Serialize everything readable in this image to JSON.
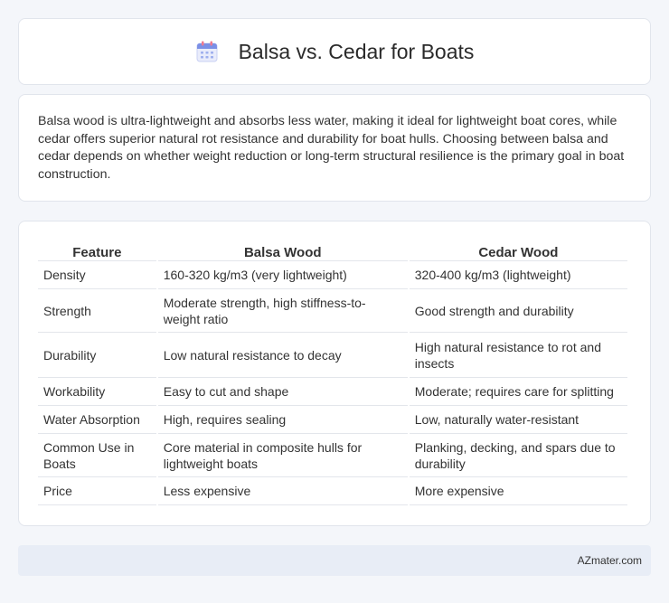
{
  "header": {
    "icon": "calendar-icon",
    "title": "Balsa vs. Cedar for Boats"
  },
  "intro": {
    "text": "Balsa wood is ultra-lightweight and absorbs less water, making it ideal for lightweight boat cores, while cedar offers superior natural rot resistance and durability for boat hulls. Choosing between balsa and cedar depends on whether weight reduction or long-term structural resilience is the primary goal in boat construction."
  },
  "table": {
    "headers": [
      "Feature",
      "Balsa Wood",
      "Cedar Wood"
    ],
    "rows": [
      [
        "Density",
        "160-320 kg/m3 (very lightweight)",
        "320-400 kg/m3 (lightweight)"
      ],
      [
        "Strength",
        "Moderate strength, high stiffness-to-weight ratio",
        "Good strength and durability"
      ],
      [
        "Durability",
        "Low natural resistance to decay",
        "High natural resistance to rot and insects"
      ],
      [
        "Workability",
        "Easy to cut and shape",
        "Moderate; requires care for splitting"
      ],
      [
        "Water Absorption",
        "High, requires sealing",
        "Low, naturally water-resistant"
      ],
      [
        "Common Use in Boats",
        "Core material in composite hulls for lightweight boats",
        "Planking, decking, and spars due to durability"
      ],
      [
        "Price",
        "Less expensive",
        "More expensive"
      ]
    ]
  },
  "footer": {
    "text": "AZmater.com"
  },
  "colors": {
    "background": "#f4f6fa",
    "card": "#ffffff",
    "footer": "#e8edf6",
    "icon_accent": "#7b8fe6"
  }
}
